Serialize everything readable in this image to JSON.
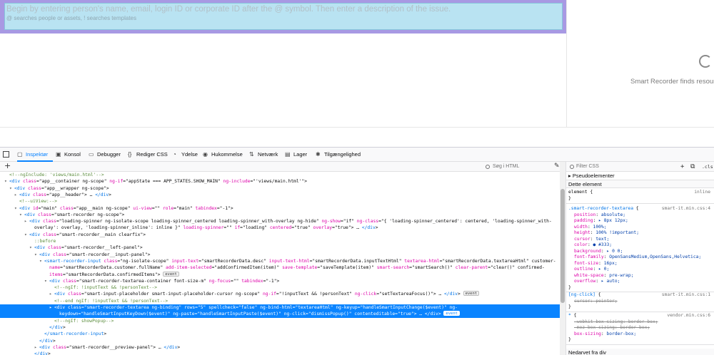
{
  "app": {
    "placeholder": "Begin by entering person's name, email, login ID or corporate ID after the @ symbol. Then enter a description of the issue.",
    "helper": "@ searches people or assets, ! searches templates",
    "preview_text": "Smart Recorder finds resource"
  },
  "devtools": {
    "tabs": [
      {
        "label": "Inspektør",
        "icon": "inspector-icon"
      },
      {
        "label": "Konsol",
        "icon": "console-icon"
      },
      {
        "label": "Debugger",
        "icon": "debugger-icon"
      },
      {
        "label": "Rediger CSS",
        "icon": "style-editor-icon"
      },
      {
        "label": "Ydelse",
        "icon": "performance-icon"
      },
      {
        "label": "Hukommelse",
        "icon": "memory-icon"
      },
      {
        "label": "Netværk",
        "icon": "network-icon"
      },
      {
        "label": "Lager",
        "icon": "storage-icon"
      },
      {
        "label": "Tilgængelighed",
        "icon": "accessibility-icon"
      }
    ],
    "html_search_placeholder": "Søg i HTML",
    "css_filter_placeholder": "Filter CSS",
    "rules_cls_label": ".cls",
    "pseudo_label": "Pseudoelementer",
    "this_element_label": "Dette element",
    "inherited_label": "Nedarvet fra div",
    "selected_color": "#0a84ff"
  },
  "markup_lines": [
    "<!--ngInclude: 'views/main.html'-->",
    "<div class=\"app__container ng-scope\" ng-if=\"appState === APP_STATES.SHOW_MAIN\" ng-include=\"'views/main.html'\">",
    "<div class=\"app__wrapper ng-scope\">",
    "<div class=\"app__header\"> … </div>",
    "<!--uiView:-->",
    "<div id=\"main\" class=\"app__main ng-scope\" ui-view=\"\" role=\"main\" tabindex=\"-1\">",
    "<div class=\"smart-recorder ng-scope\">",
    "<div class=\"loading-spinner ng-isolate-scope loading-spinner_centered loading-spinner_with-overlay ng-hide\" ng-show=\"if\" ng-class=\"{ 'loading-spinner_centered': centered, 'loading-spinner_with-",
    "overlay': overlay, 'loading-spinner_inline': inline }\" loading-spinner=\"\" if=\"loading\" centered=\"true\" overlay=\"true\"> … </div>",
    "<div class=\"smart-recorder__main clearfix\">",
    "::before",
    "<div class=\"smart-recorder__left-panel\">",
    "<div class=\"smart-recorder__input-panel\">",
    "<smart-recorder-input class=\"ng-isolate-scope\" input-text=\"smartRecorderData.desc\" input-text-html=\"smartRecorderData.inputTextHtml\" textarea-html=\"smartRecorderData.textareaHtml\" customer-",
    "name=\"smartRecorderData.customer.fullName\" add-item-selected=\"addConfirmedItem(item)\" save-template=\"saveTemplate(item)\" smart-search=\"smartSearch()\" clear-parent=\"clear()\" confirmed-",
    "items=\"smartRecorderData.confirmedItems\">",
    "<div class=\"smart-recorder-textarea-container font-size-m\" ng-focus=\"\" tabindex=\"-1\">",
    "<!--ngIf: !inputText && !personText-->",
    "<div class=\"smart-input-placeholder smart-input-placeholder-cursor ng-scope\" ng-if=\"!inputText && !personText\" ng-click=\"setTextareaFocus()\"> … </div>",
    "<!--end ngIf: !inputText && !personText-->",
    "<div class=\"smart-recorder-textarea ng-binding\" rows=\"5\" spellcheck=\"false\" ng-bind-html=\"textareaHtml\" ng-keyup=\"handleSmartInputChange($event)\" ng-",
    "keydown=\"handleSmartInputKeyDown($event)\" ng-paste=\"handleSmartInputPaste($event)\" ng-click=\"dismissPopup()\" contenteditable=\"true\"> … </div>",
    "<!--ngIf: showPopup-->",
    "</div>",
    "</smart-recorder-input>",
    "</div>",
    "<div class=\"smart-recorder__preview-panel\"> … </div>",
    "</div>"
  ],
  "markup_badges": {
    "line_18": "event",
    "line_21": "event",
    "line_16": "event"
  },
  "rules": {
    "element": {
      "selector": "element",
      "source": "inline",
      "body": "{"
    },
    "r1": {
      "selector": ".smart-recorder-textarea",
      "source": "smart-it.min.css:4",
      "props": [
        "position: absolute;",
        "padding: ▸ 8px 12px;",
        "width: 100%;",
        "height: 100% !important;",
        "cursor: text;",
        "color: ● #333;",
        "background: ▸ 0 0;",
        "font-family: OpenSansMedium,OpenSans,Helvetica;",
        "font-size: 16px;",
        "outline: ▸ 0;",
        "white-space: pre-wrap;",
        "overflow: ▸ auto;"
      ]
    },
    "r2": {
      "selector": "[ng-click]",
      "source": "smart-it.min.css:1",
      "props": [
        "cursor: pointer;"
      ]
    },
    "r3": {
      "selector": "*",
      "source": "vendor.min.css:6",
      "props": [
        "-webkit-box-sizing: border-box;",
        "-moz-box-sizing: border-box;",
        "box-sizing: border-box;"
      ]
    }
  }
}
